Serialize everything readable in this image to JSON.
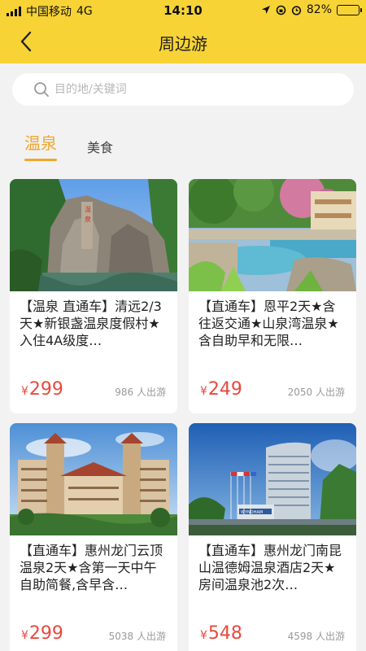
{
  "status": {
    "carrier": "中国移动",
    "network": "4G",
    "time": "14:10",
    "battery": "82%",
    "battery_level": 0.82
  },
  "header": {
    "title": "周边游"
  },
  "search": {
    "placeholder": "目的地/关键词"
  },
  "tabs": [
    {
      "label": "温泉"
    },
    {
      "label": "美食"
    }
  ],
  "currency": "¥",
  "cards": [
    {
      "title": "【温泉 直通车】清远2/3天★新银盏温泉度假村★入住4A级度…",
      "price": "299",
      "count": "986 人出游"
    },
    {
      "title": "【直通车】恩平2天★含往返交通★山泉湾温泉★含自助早和无限…",
      "price": "249",
      "count": "2050 人出游"
    },
    {
      "title": "【直通车】惠州龙门云顶温泉2天★含第一天中午自助简餐,含早含…",
      "price": "299",
      "count": "5038 人出游"
    },
    {
      "title": "【直通车】惠州龙门南昆山温德姆温泉酒店2天★房间温泉池2次…",
      "price": "548",
      "count": "4598 人出游"
    }
  ],
  "hotel_sign": "WYNDHAM"
}
